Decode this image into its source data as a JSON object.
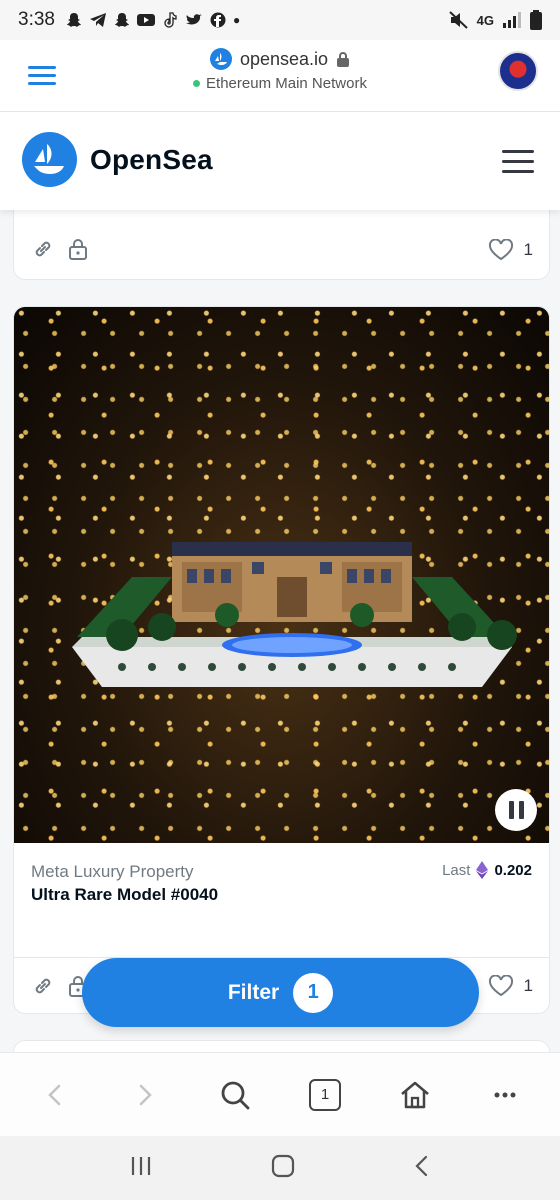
{
  "status_bar": {
    "time": "3:38",
    "network": "4G"
  },
  "browser": {
    "domain": "opensea.io",
    "network_status": "Ethereum Main Network"
  },
  "header": {
    "brand": "OpenSea"
  },
  "top_card": {
    "favorites": "1"
  },
  "nft_card": {
    "collection": "Meta Luxury Property",
    "title": "Ultra Rare Model #0040",
    "price_label": "Last",
    "price_value": "0.202",
    "currency_icon": "eth-icon",
    "favorites": "1"
  },
  "filter_button": {
    "label": "Filter",
    "count": "1"
  },
  "toolbar": {
    "tab_count": "1"
  },
  "colors": {
    "accent": "#2081e2",
    "text": "#04111d",
    "muted": "#707a83"
  }
}
